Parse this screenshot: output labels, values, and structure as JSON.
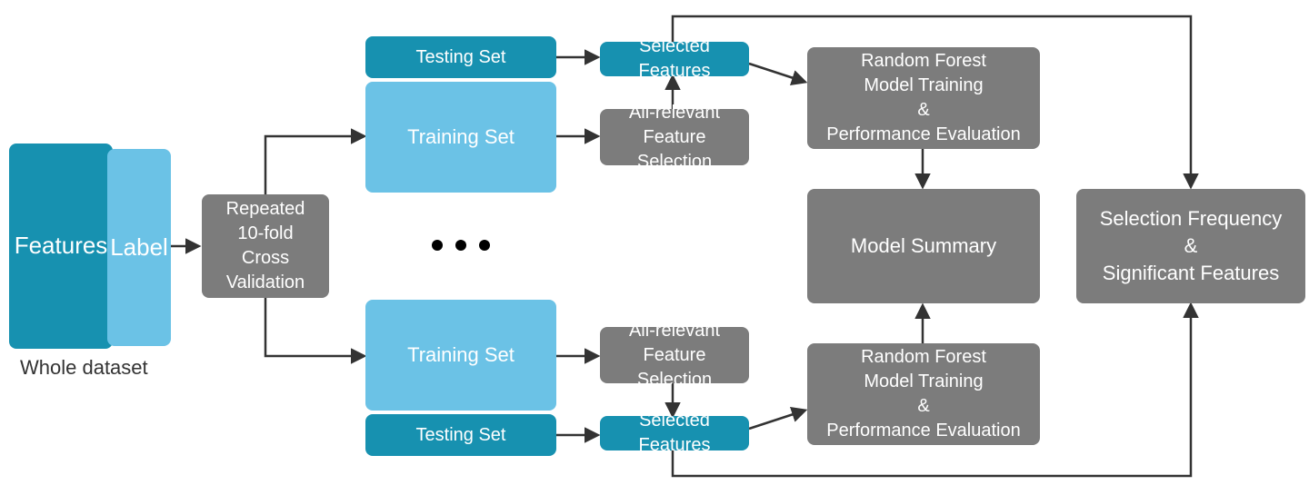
{
  "dataset": {
    "features": "Features",
    "label": "Label",
    "caption": "Whole dataset"
  },
  "cv": "Repeated\n10-fold\nCross Validation",
  "fold_top": {
    "testing": "Testing Set",
    "training": "Training Set",
    "feature_sel": "All-relevant\nFeature Selection",
    "selected": "Selected Features",
    "rf": "Random Forest\nModel Training\n&\nPerformance Evaluation"
  },
  "ellipsis": "● ● ●",
  "fold_bottom": {
    "training": "Training Set",
    "testing": "Testing Set",
    "feature_sel": "All-relevant\nFeature Selection",
    "selected": "Selected Features",
    "rf": "Random Forest\nModel Training\n&\nPerformance Evaluation"
  },
  "summary": "Model Summary",
  "sel_freq": "Selection Frequency\n&\nSignificant Features"
}
